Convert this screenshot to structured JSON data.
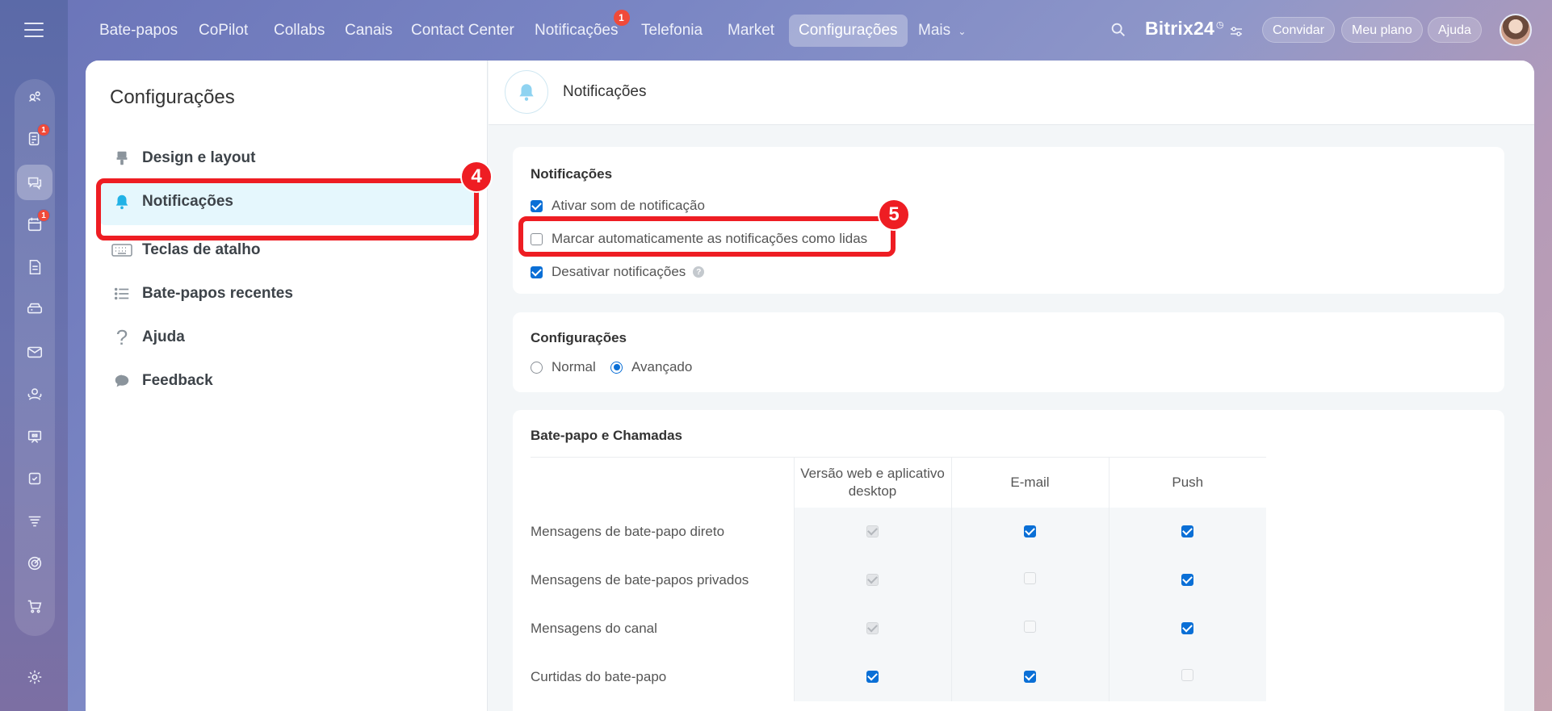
{
  "topnav": {
    "items": [
      "Bate-papos",
      "CoPilot",
      "Collabs",
      "Canais",
      "Contact Center",
      "Notificações",
      "Telefonia",
      "Market",
      "Configurações",
      "Mais"
    ],
    "notif_badge": "1",
    "brand": "Bitrix24",
    "invite": "Convidar",
    "plan": "Meu plano",
    "help": "Ajuda"
  },
  "rail": {
    "badges": [
      "1",
      "1"
    ]
  },
  "sidebar": {
    "title": "Configurações",
    "items": [
      {
        "label": "Design e layout",
        "icon": "brush-icon"
      },
      {
        "label": "Notificações",
        "icon": "bell-icon"
      },
      {
        "label": "Teclas de atalho",
        "icon": "keyboard-icon"
      },
      {
        "label": "Bate-papos recentes",
        "icon": "list-icon"
      },
      {
        "label": "Ajuda",
        "icon": "question-icon"
      },
      {
        "label": "Feedback",
        "icon": "chat-bubble-icon"
      }
    ]
  },
  "content": {
    "header_title": "Notificações",
    "notifications_card": {
      "title": "Notificações",
      "options": [
        {
          "label": "Ativar som de notificação",
          "checked": true
        },
        {
          "label": "Marcar automaticamente as notificações como lidas",
          "checked": false
        },
        {
          "label": "Desativar notificações",
          "checked": true
        }
      ]
    },
    "settings_card": {
      "title": "Configurações",
      "mode_normal": "Normal",
      "mode_advanced": "Avançado",
      "selected": "Avançado"
    },
    "chat_card": {
      "title": "Bate-papo e Chamadas",
      "columns": [
        "Versão web e aplicativo desktop",
        "E-mail",
        "Push"
      ],
      "rows": [
        {
          "label": "Mensagens de bate-papo direto",
          "states": [
            "disabled-checked",
            "checked",
            "checked"
          ]
        },
        {
          "label": "Mensagens de bate-papos privados",
          "states": [
            "disabled-checked",
            "disabled-unchecked",
            "checked"
          ]
        },
        {
          "label": "Mensagens do canal",
          "states": [
            "disabled-checked",
            "disabled-unchecked",
            "checked"
          ]
        },
        {
          "label": "Curtidas do bate-papo",
          "states": [
            "checked",
            "checked",
            "disabled-unchecked"
          ]
        }
      ]
    }
  },
  "annotations": {
    "step4": "4",
    "step5": "5"
  },
  "colors": {
    "accent": "#0a6fd6",
    "highlight": "#ee1d23",
    "active_menu_bg": "#e5f7fd"
  }
}
